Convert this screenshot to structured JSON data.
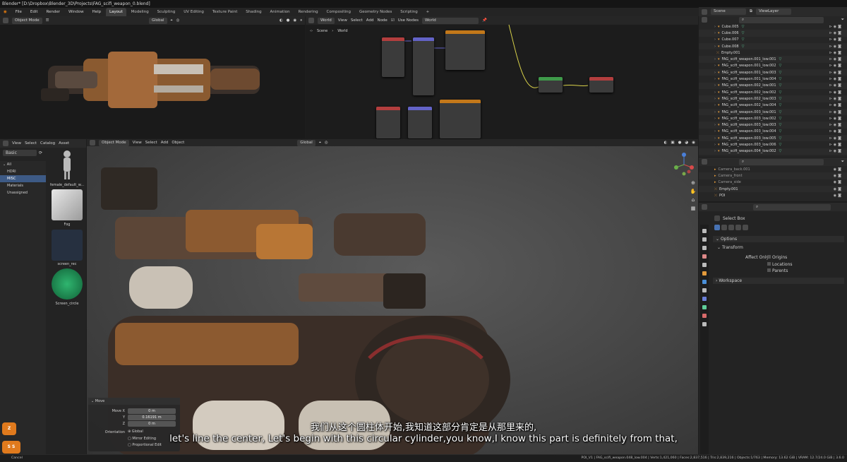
{
  "window": {
    "title": "Blender* [D:\\Dropbox\\Blender_3D\\Projects\\FAG_scifi_weapon_0.blend]"
  },
  "menu": [
    "File",
    "Edit",
    "Render",
    "Window",
    "Help"
  ],
  "workspaces": [
    "Layout",
    "Modeling",
    "Sculpting",
    "UV Editing",
    "Texture Paint",
    "Shading",
    "Animation",
    "Rendering",
    "Compositing",
    "Geometry Nodes",
    "Scripting",
    "+"
  ],
  "scene": {
    "label": "Scene",
    "view_layer": "ViewLayer"
  },
  "top_viewport": {
    "mode": "Object Mode",
    "orientation": "Global"
  },
  "node_editor": {
    "type": "World",
    "menus": [
      "View",
      "Select",
      "Add",
      "Node"
    ],
    "use_nodes": "Use Nodes",
    "breadcrumb_scene": "Scene",
    "breadcrumb_world": "World"
  },
  "outliner": {
    "items": [
      "Cube.005",
      "Cube.006",
      "Cube.007",
      "Cube.008",
      "Empty.001",
      "FAG_scifi_weapon.001_low.001",
      "FAG_scifi_weapon.001_low.002",
      "FAG_scifi_weapon.001_low.003",
      "FAG_scifi_weapon.001_low.004",
      "FAG_scifi_weapon.002_low.001",
      "FAG_scifi_weapon.002_low.002",
      "FAG_scifi_weapon.002_low.003",
      "FAG_scifi_weapon.002_low.004",
      "FAG_scifi_weapon.003_low.001",
      "FAG_scifi_weapon.003_low.002",
      "FAG_scifi_weapon.003_low.003",
      "FAG_scifi_weapon.003_low.004",
      "FAG_scifi_weapon.003_low.005",
      "FAG_scifi_weapon.003_low.006",
      "FAG_scifi_weapon.004_low.002"
    ]
  },
  "outliner2": {
    "items": [
      "Camera_back.001",
      "Camera_front",
      "Camera_side",
      "Empty.001",
      "POI"
    ]
  },
  "asset_browser": {
    "menus": [
      "View",
      "Select",
      "Catalog",
      "Asset"
    ],
    "filter": "Basic",
    "categories": [
      "All",
      "HDRI",
      "MISC",
      "Materials",
      "Unassigned"
    ],
    "assets": [
      "female_default_w...",
      "Fog",
      "screen_rec",
      "Screen_circle"
    ]
  },
  "main_viewport": {
    "mode": "Object Mode",
    "menus": [
      "View",
      "Select",
      "Add",
      "Object"
    ],
    "orientation": "Global"
  },
  "tool_props": {
    "tool": "Select Box",
    "options": "Options",
    "transform": "Transform",
    "affect_only": "Affect Only",
    "checks": [
      "Origins",
      "Locations",
      "Parents"
    ],
    "workspace": "Workspace"
  },
  "move_panel": {
    "title": "Move",
    "move_x_label": "Move X",
    "move_x": "0 m",
    "y_label": "Y",
    "y": "0.16191 m",
    "z_label": "Z",
    "z": "0 m",
    "orientation_label": "Orientation",
    "orientation": "Global",
    "mirror": "Mirror Editing",
    "proportional": "Proportional Edit"
  },
  "subtitles": {
    "zh": "我们从这个圆柱体开始,我知道这部分肯定是从那里来的,",
    "en": "let's line the center, Let's begin with this circular cylinder,you know,I know this part is definitely from that,"
  },
  "badges": {
    "z": "Z",
    "ss": "S S"
  },
  "status": {
    "left": "Cancel",
    "right": "POI_V1 | FAG_scifi_weapon.048_low.004 | Verts:1,421,060 | Faces:2,837,516 | Tris:2,839,216 | Objects:1/763 | Memory: 13.62 GiB | VRAM: 12.7/24.0 GiB | 3.6.0"
  }
}
